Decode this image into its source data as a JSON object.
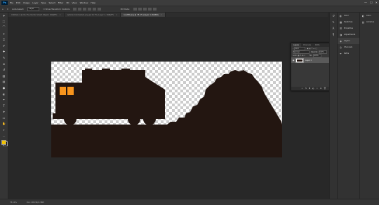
{
  "app": {
    "logo": "Ps",
    "menu": [
      "File",
      "Edit",
      "Image",
      "Layer",
      "Type",
      "Select",
      "Filter",
      "3D",
      "View",
      "Window",
      "Help"
    ],
    "window_controls": [
      "—",
      "☐",
      "✕"
    ]
  },
  "options_bar": {
    "auto_select_label": "Auto-Select:",
    "auto_select_value": "Layer",
    "transform_label": "Show Transform Controls",
    "mode_label": "3D Mode:"
  },
  "tabs": [
    {
      "label": "Untitled-1 @ 16.7% (Vector Smart Object, RGB/8*)",
      "active": false
    },
    {
      "label": "optical-minimalism.png @ 16.7% (Layer 1, RGB/8*)",
      "active": false
    },
    {
      "label": "landfill.png @ 75.1% (Layer 1, RGB/8)",
      "active": true
    }
  ],
  "toolbar_icons": [
    "move-icon",
    "marquee-icon",
    "lasso-icon",
    "quick-select-icon",
    "crop-icon",
    "eyedropper-icon",
    "healing-icon",
    "brush-icon",
    "stamp-icon",
    "history-brush-icon",
    "eraser-icon",
    "gradient-icon",
    "blur-icon",
    "dodge-icon",
    "pen-icon",
    "type-icon",
    "path-select-icon",
    "shape-icon",
    "hand-icon",
    "zoom-icon",
    "more-icon"
  ],
  "toolbar_glyphs": [
    "✛",
    "⬚",
    "⌒",
    "✦",
    "⌗",
    "✐",
    "✚",
    "✎",
    "⊕",
    "↺",
    "▧",
    "▤",
    "●",
    "◐",
    "✒",
    "T",
    "➤",
    "▭",
    "✋",
    "⌕",
    "…"
  ],
  "colors": {
    "foreground": "#f2c300",
    "background": "#000000",
    "canvas_fill": "#231611",
    "window_orange": "#f7941d"
  },
  "status": {
    "zoom": "75.11%",
    "doc": "Doc: 465.9K/1.36M"
  },
  "panels": [
    {
      "icon": "color-icon",
      "glyph": "◐",
      "label": "Color"
    },
    {
      "icon": "swatches-icon",
      "glyph": "▦",
      "label": "Swatches"
    },
    {
      "icon": "properties-icon",
      "glyph": "☰",
      "label": "Properties"
    },
    {
      "icon": "adjustments-icon",
      "glyph": "◑",
      "label": "Adjustments"
    },
    {
      "icon": "layers-icon",
      "glyph": "◈",
      "label": "Layers"
    },
    {
      "icon": "channels-icon",
      "glyph": "◎",
      "label": "Channels"
    },
    {
      "icon": "paths-icon",
      "glyph": "✒",
      "label": "Paths"
    }
  ],
  "panels2": [
    {
      "icon": "color2-icon",
      "glyph": "◐",
      "label": "Color"
    },
    {
      "icon": "libraries-icon",
      "glyph": "▤",
      "label": "Libraries"
    }
  ],
  "layers_panel": {
    "tabs": [
      "Layers",
      "Channels",
      "Paths"
    ],
    "filter": "Kind",
    "blend_mode": "Normal",
    "opacity_label": "Opacity:",
    "opacity": "100%",
    "lock_label": "Lock:",
    "fill_label": "Fill:",
    "fill": "100%",
    "layer_name": "Layer 1"
  }
}
